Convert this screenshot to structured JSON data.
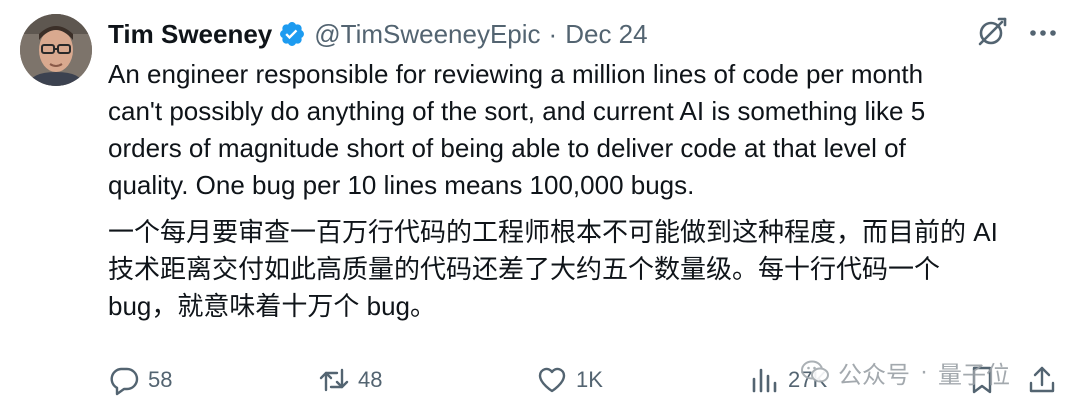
{
  "author": {
    "name": "Tim Sweeney",
    "handle": "@TimSweeneyEpic",
    "separator": "·",
    "date": "Dec 24"
  },
  "tweet": {
    "text_en": "An engineer responsible for reviewing a million lines of code per month\ncan't possibly do anything of the sort, and current AI is something like 5\norders of magnitude short of being able to deliver code at that level of\nquality. One bug per 10 lines means 100,000 bugs.",
    "text_zh": "一个每月要审查一百万行代码的工程师根本不可能做到这种程度，而目前的 AI\n技术距离交付如此高质量的代码还差了大约五个数量级。每十行代码一个\nbug，就意味着十万个 bug。"
  },
  "stats": {
    "replies": "58",
    "reposts": "48",
    "likes": "1K",
    "views": "27K"
  },
  "watermark": {
    "source": "公众号",
    "separator": "·",
    "account": "量子位"
  },
  "icons": {
    "verified": "verified-badge-icon",
    "grok": "grok-icon",
    "more": "more-icon",
    "reply": "reply-icon",
    "repost": "repost-icon",
    "like": "heart-icon",
    "views": "views-icon",
    "bookmark": "bookmark-icon",
    "share": "share-icon"
  },
  "colors": {
    "verified_blue": "#1d9bf0",
    "text_primary": "#0f1419",
    "text_secondary": "#536471"
  }
}
